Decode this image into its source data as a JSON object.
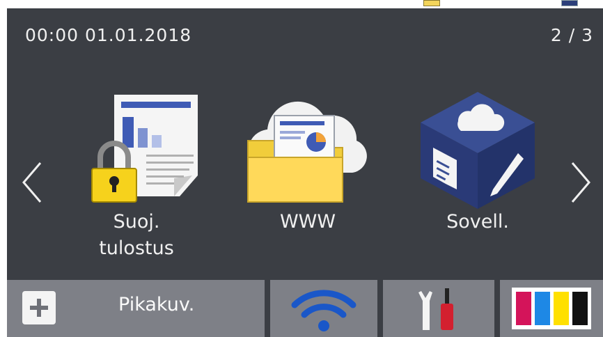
{
  "status_bar": {
    "datetime": "00:00  01.01.2018",
    "page_indicator": "2 / 3"
  },
  "apps": [
    {
      "label": "Suoj.\ntulostus",
      "icon": "secure-print-icon"
    },
    {
      "label": "WWW",
      "icon": "web-connect-icon"
    },
    {
      "label": "Sovell.",
      "icon": "apps-cube-icon"
    }
  ],
  "navigation": {
    "prev_icon": "chevron-left-icon",
    "next_icon": "chevron-right-icon"
  },
  "bottom_bar": {
    "shortcut_label": "Pikakuv.",
    "shortcut_icon": "plus-icon",
    "wifi_icon": "wifi-icon",
    "tools_icon": "tools-icon",
    "ink_icon": "ink-levels-icon"
  },
  "colors": {
    "background": "#3b3e44",
    "button": "#7e8087",
    "wifi_blue": "#1a57c8",
    "ink_magenta": "#d4145a",
    "ink_cyan": "#1e88e5",
    "ink_yellow": "#ffe000",
    "ink_black": "#111111"
  }
}
